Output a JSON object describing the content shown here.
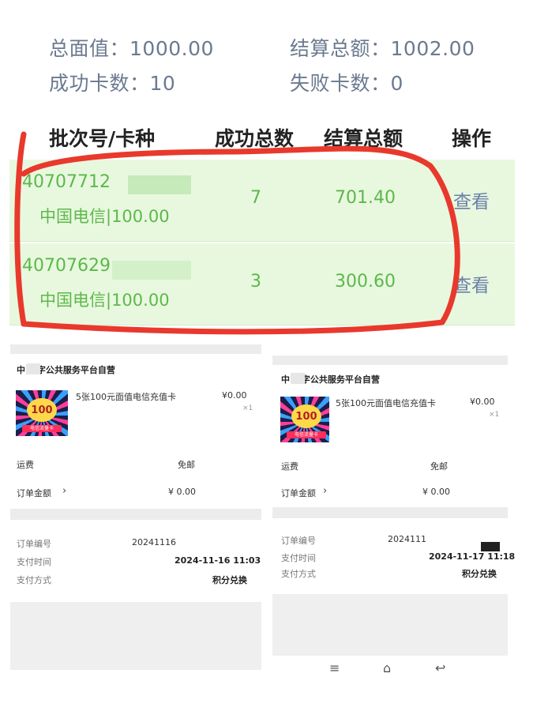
{
  "summary": {
    "total_face_label": "总面值：",
    "total_face_value": "1000.00",
    "settle_total_label": "结算总额：",
    "settle_total_value": "1002.00",
    "success_cards_label": "成功卡数：",
    "success_cards_value": "10",
    "failed_cards_label": "失败卡数：",
    "failed_cards_value": "0"
  },
  "table": {
    "headers": [
      "批次号/卡种",
      "成功总数",
      "结算总额",
      "操作"
    ],
    "rows": [
      {
        "batch": "40707712",
        "card_type": "中国电信|100.00",
        "count": "7",
        "amount": "701.40",
        "action": "查看"
      },
      {
        "batch": "40707629",
        "card_type": "中国电信|100.00",
        "count": "3",
        "amount": "300.60",
        "action": "查看"
      }
    ]
  },
  "orders": [
    {
      "shop": "中 数字公共服务平台自营",
      "product_name": "5张100元面值电信充值卡",
      "price": "¥0.00",
      "qty": "×1",
      "thumb_value": "100",
      "thumb_caption": "电信流量卡",
      "shipping_label": "运费",
      "shipping_value": "免邮",
      "order_amount_label": "订单金额",
      "order_amount_value": "¥ 0.00",
      "order_no_label": "订单编号",
      "order_no_value": "20241116",
      "pay_time_label": "支付时间",
      "pay_time_value": "2024-11-16 11:03",
      "pay_method_label": "支付方式",
      "pay_method_value": "积分兑换"
    },
    {
      "shop": "中 数字公共服务平台自营",
      "product_name": "5张100元面值电信充值卡",
      "price": "¥0.00",
      "qty": "×1",
      "thumb_value": "100",
      "thumb_caption": "电信流量卡",
      "shipping_label": "运费",
      "shipping_value": "免邮",
      "order_amount_label": "订单金额",
      "order_amount_value": "¥ 0.00",
      "order_no_label": "订单编号",
      "order_no_value": "2024111",
      "pay_time_label": "支付时间",
      "pay_time_value": "2024-11-17 11:18",
      "pay_method_label": "支付方式",
      "pay_method_value": "积分兑换"
    }
  ],
  "navbar": {
    "menu": "≡",
    "home": "⌂",
    "back": "↩"
  },
  "colors": {
    "green": "#5db84a",
    "row_bg": "#e8f8df",
    "link": "#6b80a8",
    "annotation": "#e8392c"
  }
}
